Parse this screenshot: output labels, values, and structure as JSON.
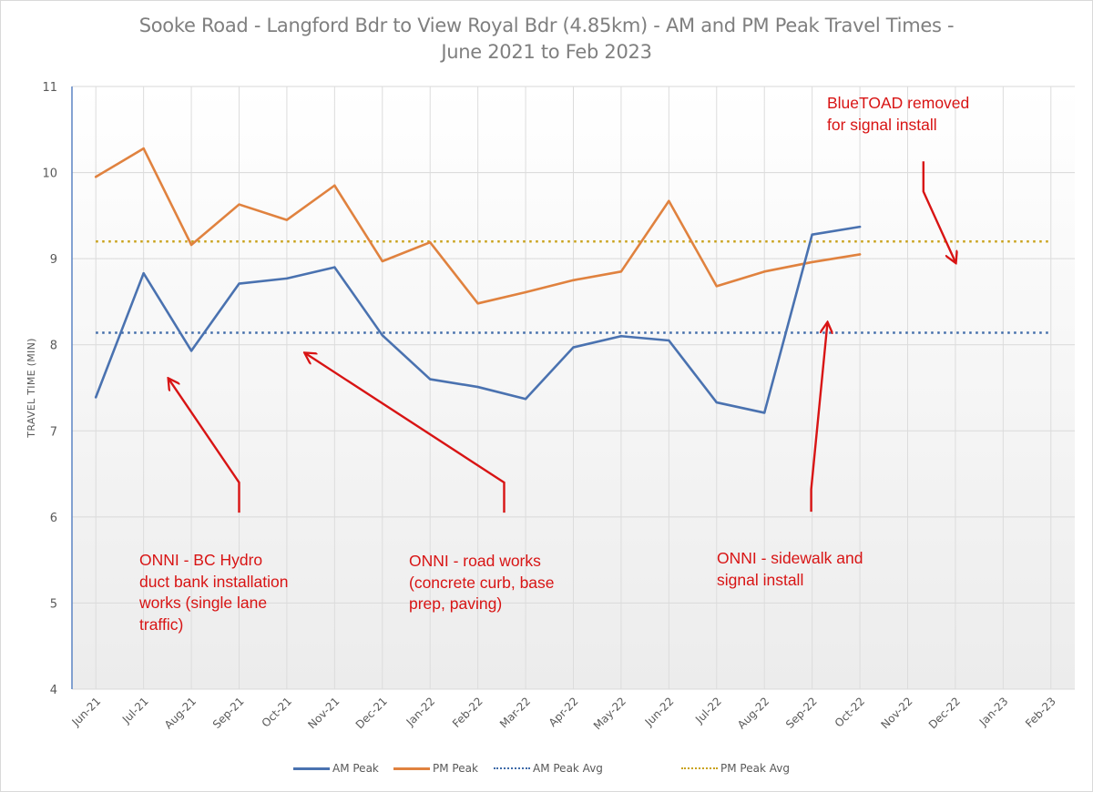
{
  "chart_data": {
    "type": "line",
    "title": "Sooke Road - Langford Bdr to View Royal Bdr (4.85km) - AM and PM Peak Travel Times - June 2021 to Feb 2023",
    "title_lines": [
      "Sooke Road - Langford Bdr to View Royal Bdr (4.85km) - AM and PM Peak Travel Times -",
      "June 2021 to Feb 2023"
    ],
    "xlabel": "",
    "ylabel": "TRAVEL TIME (MIN)",
    "ylim": [
      4,
      11
    ],
    "yticks": [
      "4",
      "5",
      "6",
      "7",
      "8",
      "9",
      "10",
      "11"
    ],
    "grid": true,
    "legend_position": "bottom",
    "categories": [
      "Jun-21",
      "Jul-21",
      "Aug-21",
      "Sep-21",
      "Oct-21",
      "Nov-21",
      "Dec-21",
      "Jan-22",
      "Feb-22",
      "Mar-22",
      "Apr-22",
      "May-22",
      "Jun-22",
      "Jul-22",
      "Aug-22",
      "Sep-22",
      "Oct-22",
      "Nov-22",
      "Dec-22",
      "Jan-23",
      "Feb-23"
    ],
    "series": [
      {
        "name": "AM Peak",
        "style": "solid",
        "color": "#4a72b0",
        "values": [
          7.39,
          8.83,
          7.93,
          8.71,
          8.77,
          8.9,
          8.11,
          7.6,
          7.51,
          7.37,
          7.97,
          8.1,
          8.05,
          7.33,
          7.21,
          9.28,
          9.37,
          null,
          null,
          null,
          null
        ]
      },
      {
        "name": "PM Peak",
        "style": "solid",
        "color": "#e0823f",
        "values": [
          9.95,
          10.28,
          9.16,
          9.63,
          9.45,
          9.85,
          8.97,
          9.19,
          8.48,
          8.61,
          8.75,
          8.85,
          9.67,
          8.68,
          8.85,
          8.96,
          9.05,
          null,
          null,
          null,
          null
        ]
      },
      {
        "name": "AM Peak Avg",
        "style": "dotted",
        "color": "#3e6aa8",
        "values": [
          8.14,
          8.14,
          8.14,
          8.14,
          8.14,
          8.14,
          8.14,
          8.14,
          8.14,
          8.14,
          8.14,
          8.14,
          8.14,
          8.14,
          8.14,
          8.14,
          8.14,
          8.14,
          8.14,
          8.14,
          8.14
        ]
      },
      {
        "name": "PM Peak Avg",
        "style": "dotted",
        "color": "#c9a21a",
        "values": [
          9.2,
          9.2,
          9.2,
          9.2,
          9.2,
          9.2,
          9.2,
          9.2,
          9.2,
          9.2,
          9.2,
          9.2,
          9.2,
          9.2,
          9.2,
          9.2,
          9.2,
          9.2,
          9.2,
          9.2,
          9.2
        ]
      }
    ],
    "annotations": [
      {
        "text": "ONNI - BC Hydro\nduct bank installation\nworks (single lane\ntraffic)",
        "arrow_from": {
          "category_index": 3.0,
          "value": 6.05
        },
        "arrow_bend": {
          "category_index": 3.0,
          "value": 6.4
        },
        "arrow_to": {
          "category_index": 1.53,
          "value": 7.6
        }
      },
      {
        "text": "ONNI - road works\n(concrete curb, base\nprep, paving)",
        "arrow_from": {
          "category_index": 8.55,
          "value": 6.05
        },
        "arrow_bend": {
          "category_index": 8.55,
          "value": 6.4
        },
        "arrow_to": {
          "category_index": 4.39,
          "value": 7.9
        }
      },
      {
        "text": "ONNI - sidewalk and\nsignal install",
        "arrow_from": {
          "category_index": 14.98,
          "value": 6.06
        },
        "arrow_bend": {
          "category_index": 14.98,
          "value": 6.32
        },
        "arrow_to": {
          "category_index": 15.32,
          "value": 8.25
        }
      },
      {
        "text": "BlueTOAD removed\nfor signal install",
        "arrow_from": {
          "category_index": 17.33,
          "value": 10.13
        },
        "arrow_bend": {
          "category_index": 17.33,
          "value": 9.78
        },
        "arrow_to": {
          "category_index": 18.0,
          "value": 8.96
        }
      }
    ],
    "annotation_color": "#d81414"
  }
}
